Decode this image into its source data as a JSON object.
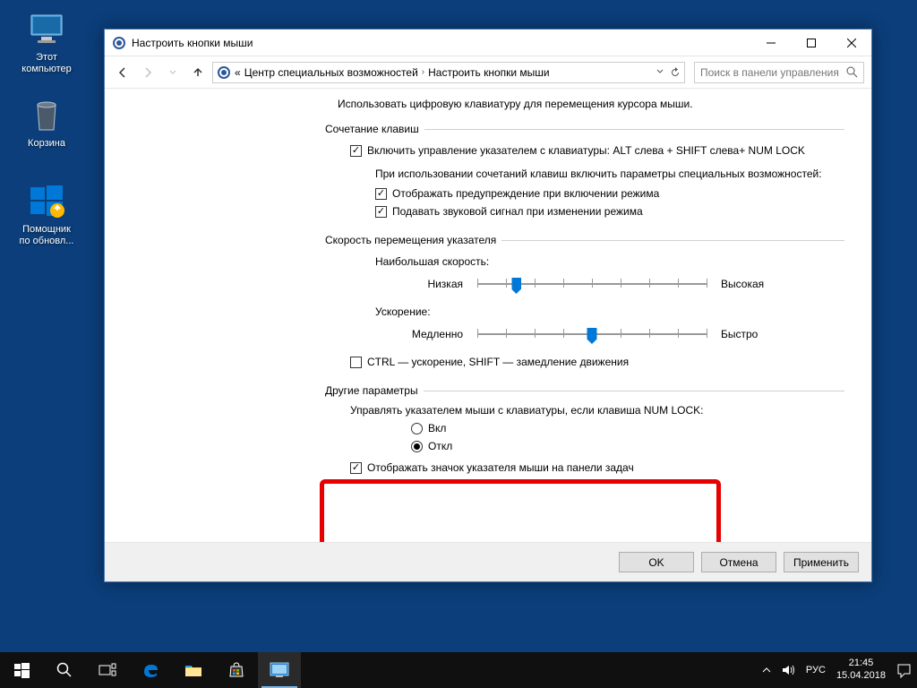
{
  "desktop": {
    "this_pc": "Этот\nкомпьютер",
    "recycle_bin": "Корзина",
    "update_assistant": "Помощник\nпо обновл..."
  },
  "window": {
    "title": "Настроить кнопки мыши",
    "breadcrumb": {
      "prefix": "«",
      "level1": "Центр специальных возможностей",
      "level2": "Настроить кнопки мыши"
    },
    "search_placeholder": "Поиск в панели управления",
    "desc": "Использовать цифровую клавиатуру для перемещения курсора мыши.",
    "group_shortcut": "Сочетание клавиш",
    "cb_enable_pointer": "Включить управление указателем с клавиатуры: ALT слева + SHIFT слева+ NUM LOCK",
    "shortcut_note": "При использовании сочетаний клавиш включить параметры специальных возможностей:",
    "cb_show_warning": "Отображать предупреждение при включении режима",
    "cb_play_sound": "Подавать звуковой сигнал при изменении режима",
    "group_speed": "Скорость перемещения указателя",
    "top_speed": "Наибольшая скорость:",
    "low": "Низкая",
    "high": "Высокая",
    "accel": "Ускорение:",
    "slow": "Медленно",
    "fast": "Быстро",
    "cb_ctrl_shift": "CTRL — ускорение, SHIFT — замедление движения",
    "group_other": "Другие параметры",
    "numlock_note": "Управлять указателем мыши с клавиатуры, если клавиша NUM LOCK:",
    "radio_on": "Вкл",
    "radio_off": "Откл",
    "cb_show_taskbar_icon": "Отображать значок указателя мыши на панели задач",
    "btn_ok": "OK",
    "btn_cancel": "Отмена",
    "btn_apply": "Применить"
  },
  "taskbar": {
    "lang": "РУС",
    "time": "21:45",
    "date": "15.04.2018"
  }
}
